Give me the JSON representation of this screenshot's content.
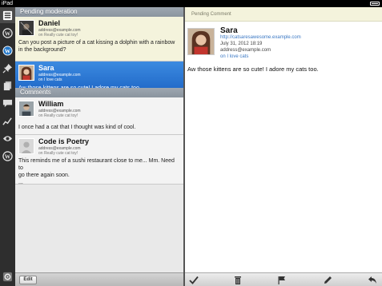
{
  "status_bar": {
    "carrier": "iPad",
    "time": ""
  },
  "rail": {
    "items": [
      {
        "icon": "comments-list-icon"
      },
      {
        "icon": "wordpress-logo-icon"
      },
      {
        "icon": "wordpress-logo-icon"
      },
      {
        "icon": "pin-icon"
      },
      {
        "icon": "pages-icon"
      },
      {
        "icon": "speech-bubble-icon"
      },
      {
        "icon": "stats-icon"
      },
      {
        "icon": "eye-icon"
      },
      {
        "icon": "wordpress-logo-icon"
      }
    ]
  },
  "sections": {
    "pending": "Pending moderation",
    "comments": "Comments"
  },
  "pending_comments": [
    {
      "author": "Daniel",
      "email": "address@example.com",
      "post": "on Really cute cat toy!",
      "text_lines": [
        "Can you post a picture of a cat kissing a dolphin with a rainbow",
        "in the background?"
      ]
    },
    {
      "author": "Sara",
      "email": "address@example.com",
      "post": "on I love cats",
      "text_lines": [
        "Aw those kittens are so cute! I adore my cats too."
      ]
    }
  ],
  "comments": [
    {
      "author": "William",
      "email": "address@example.com",
      "post": "on Really cute cat toy!",
      "text_lines": [
        "I once had a cat that I thought was kind of cool."
      ]
    },
    {
      "author": "Code is Poetry",
      "email": "address@example.com",
      "post": "on Really cute cat toy!",
      "text_lines": [
        "This reminds me of a sushi restaurant close to me... Mm. Need to",
        "go there again soon.",
        "..."
      ]
    }
  ],
  "list_toolbar": {
    "edit_label": "Edit"
  },
  "detail": {
    "header": "Pending Comment",
    "author": "Sara",
    "url": "http://catsaresawesome.example.com",
    "date": "July 31, 2012 18:19",
    "email": "address@example.com",
    "post": "on I love cats",
    "body": "Aw those kittens are so cute! I adore my cats too."
  },
  "detail_toolbar": {
    "tools": [
      "approve-check-icon",
      "trash-icon",
      "flag-spam-icon",
      "edit-pencil-icon",
      "reply-icon"
    ]
  },
  "colors": {
    "selected_row": "#2a72d0",
    "pending_bg": "#f4f3dc",
    "link": "#3a78c4"
  }
}
